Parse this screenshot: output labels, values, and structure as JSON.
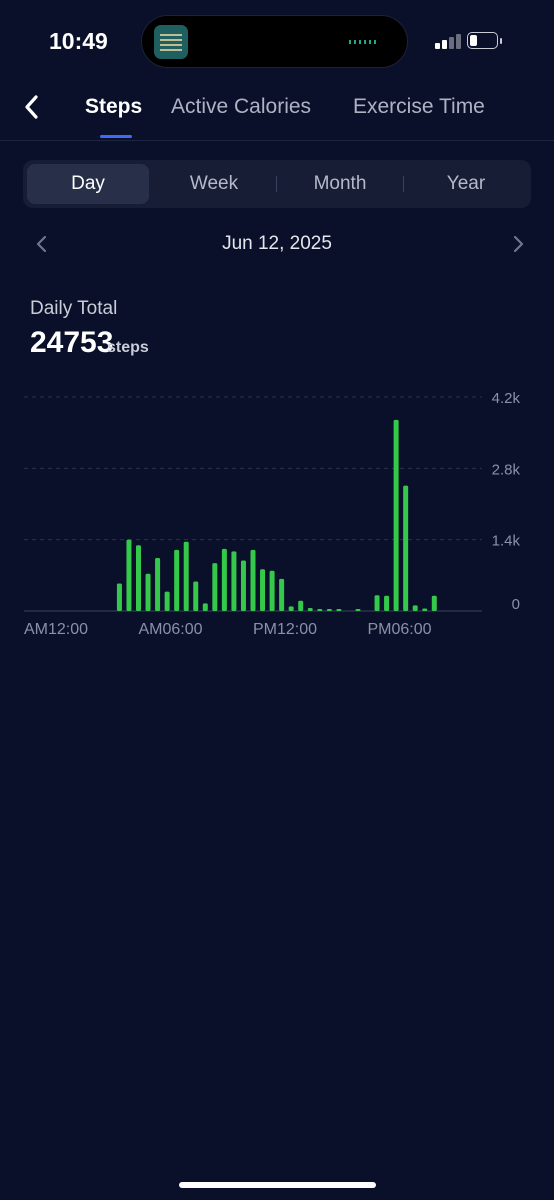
{
  "status_bar": {
    "time": "10:49",
    "signal_icon": "cellular-signal-icon",
    "battery_icon": "battery-icon"
  },
  "nav": {
    "back_icon": "chevron-left-icon",
    "tabs": [
      {
        "label": "Steps",
        "active": true
      },
      {
        "label": "Active Calories",
        "active": false
      },
      {
        "label": "Exercise Time",
        "active": false
      }
    ],
    "accent": "#3b6cf5"
  },
  "period_selector": {
    "options": [
      "Day",
      "Week",
      "Month",
      "Year"
    ],
    "selected": "Day"
  },
  "date_nav": {
    "date": "Jun 12, 2025",
    "prev_icon": "chevron-left-icon",
    "next_icon": "chevron-right-icon"
  },
  "summary": {
    "label": "Daily Total",
    "value": "24753",
    "unit": "steps"
  },
  "chart_data": {
    "type": "bar",
    "bar_color": "#34c94a",
    "grid": true,
    "x_ticks": [
      "AM12:00",
      "AM06:00",
      "PM12:00",
      "PM06:00"
    ],
    "x_tick_hours": [
      0,
      6,
      12,
      18
    ],
    "y_ticks": [
      "4.2k",
      "2.8k",
      "1.4k",
      "0"
    ],
    "y_tick_values": [
      4200,
      2800,
      1400,
      0
    ],
    "ylim": [
      0,
      4200
    ],
    "bars": [
      {
        "hour": 5.0,
        "value": 540
      },
      {
        "hour": 5.5,
        "value": 1400
      },
      {
        "hour": 6.0,
        "value": 1290
      },
      {
        "hour": 6.5,
        "value": 730
      },
      {
        "hour": 7.0,
        "value": 1040
      },
      {
        "hour": 7.5,
        "value": 380
      },
      {
        "hour": 8.0,
        "value": 1200
      },
      {
        "hour": 8.5,
        "value": 1360
      },
      {
        "hour": 9.0,
        "value": 580
      },
      {
        "hour": 9.5,
        "value": 150
      },
      {
        "hour": 10.0,
        "value": 940
      },
      {
        "hour": 10.5,
        "value": 1220
      },
      {
        "hour": 11.0,
        "value": 1170
      },
      {
        "hour": 11.5,
        "value": 990
      },
      {
        "hour": 12.0,
        "value": 1200
      },
      {
        "hour": 12.5,
        "value": 820
      },
      {
        "hour": 13.0,
        "value": 790
      },
      {
        "hour": 13.5,
        "value": 630
      },
      {
        "hour": 14.0,
        "value": 90
      },
      {
        "hour": 14.5,
        "value": 200
      },
      {
        "hour": 15.0,
        "value": 60
      },
      {
        "hour": 15.5,
        "value": 40
      },
      {
        "hour": 16.0,
        "value": 40
      },
      {
        "hour": 16.5,
        "value": 30
      },
      {
        "hour": 17.5,
        "value": 40
      },
      {
        "hour": 18.5,
        "value": 310
      },
      {
        "hour": 19.0,
        "value": 300
      },
      {
        "hour": 19.5,
        "value": 3750
      },
      {
        "hour": 20.0,
        "value": 2460
      },
      {
        "hour": 20.5,
        "value": 110
      },
      {
        "hour": 21.0,
        "value": 50
      },
      {
        "hour": 21.5,
        "value": 300
      }
    ]
  }
}
